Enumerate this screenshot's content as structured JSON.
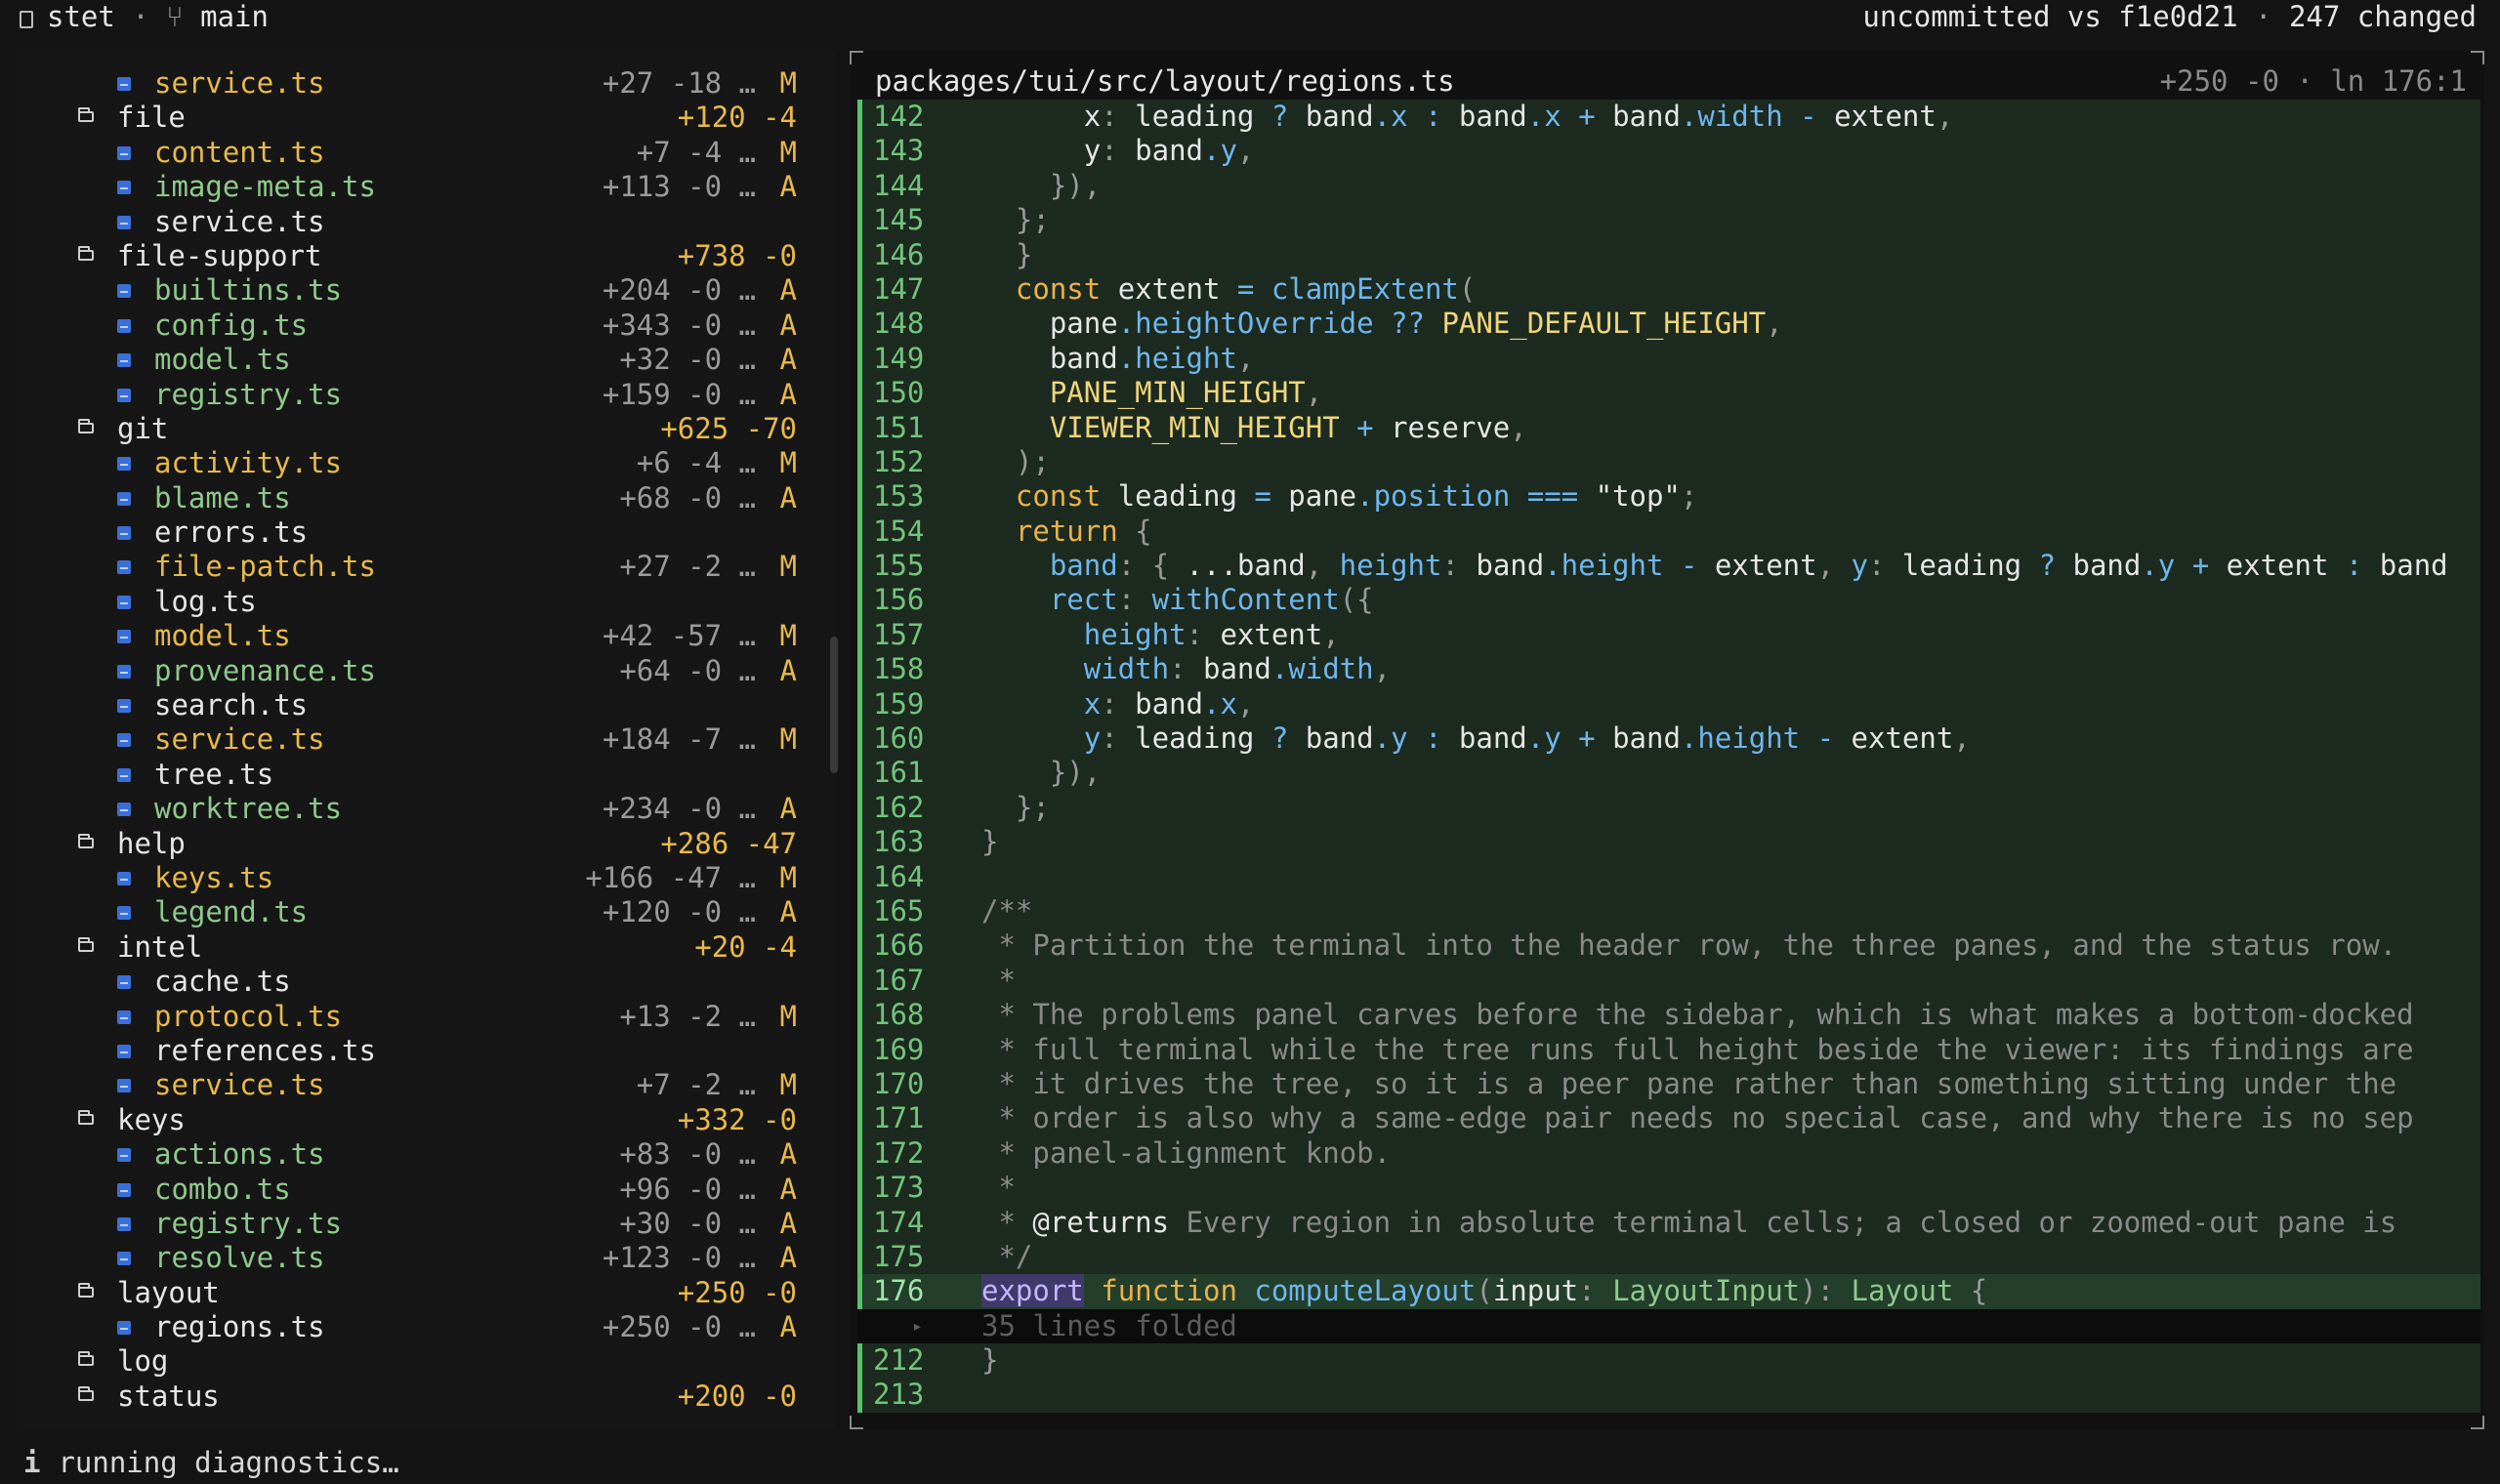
{
  "header": {
    "app_name": "stet",
    "separator": "·",
    "branch": "main",
    "compare": "uncommitted vs f1e0d21",
    "changed": "247 changed"
  },
  "sidebar": {
    "rows": [
      {
        "kind": "file",
        "depth": 2,
        "name": "service.ts",
        "stats": "+27 -18 …",
        "status": "M",
        "color": "yellow"
      },
      {
        "kind": "dir",
        "depth": 1,
        "name": "file",
        "stats": "+120 -4",
        "status": ""
      },
      {
        "kind": "file",
        "depth": 2,
        "name": "content.ts",
        "stats": "+7 -4 …",
        "status": "M",
        "color": "yellow"
      },
      {
        "kind": "file",
        "depth": 2,
        "name": "image-meta.ts",
        "stats": "+113 -0 …",
        "status": "A",
        "color": "green"
      },
      {
        "kind": "file",
        "depth": 2,
        "name": "service.ts",
        "stats": "",
        "status": "",
        "color": "white"
      },
      {
        "kind": "dir",
        "depth": 1,
        "name": "file-support",
        "stats": "+738 -0",
        "status": ""
      },
      {
        "kind": "file",
        "depth": 2,
        "name": "builtins.ts",
        "stats": "+204 -0 …",
        "status": "A",
        "color": "green"
      },
      {
        "kind": "file",
        "depth": 2,
        "name": "config.ts",
        "stats": "+343 -0 …",
        "status": "A",
        "color": "green"
      },
      {
        "kind": "file",
        "depth": 2,
        "name": "model.ts",
        "stats": "+32 -0 …",
        "status": "A",
        "color": "green"
      },
      {
        "kind": "file",
        "depth": 2,
        "name": "registry.ts",
        "stats": "+159 -0 …",
        "status": "A",
        "color": "green"
      },
      {
        "kind": "dir",
        "depth": 1,
        "name": "git",
        "stats": "+625 -70",
        "status": ""
      },
      {
        "kind": "file",
        "depth": 2,
        "name": "activity.ts",
        "stats": "+6 -4 …",
        "status": "M",
        "color": "yellow"
      },
      {
        "kind": "file",
        "depth": 2,
        "name": "blame.ts",
        "stats": "+68 -0 …",
        "status": "A",
        "color": "green"
      },
      {
        "kind": "file",
        "depth": 2,
        "name": "errors.ts",
        "stats": "",
        "status": "",
        "color": "white"
      },
      {
        "kind": "file",
        "depth": 2,
        "name": "file-patch.ts",
        "stats": "+27 -2 …",
        "status": "M",
        "color": "yellow"
      },
      {
        "kind": "file",
        "depth": 2,
        "name": "log.ts",
        "stats": "",
        "status": "",
        "color": "white"
      },
      {
        "kind": "file",
        "depth": 2,
        "name": "model.ts",
        "stats": "+42 -57 …",
        "status": "M",
        "color": "yellow"
      },
      {
        "kind": "file",
        "depth": 2,
        "name": "provenance.ts",
        "stats": "+64 -0 …",
        "status": "A",
        "color": "green"
      },
      {
        "kind": "file",
        "depth": 2,
        "name": "search.ts",
        "stats": "",
        "status": "",
        "color": "white"
      },
      {
        "kind": "file",
        "depth": 2,
        "name": "service.ts",
        "stats": "+184 -7 …",
        "status": "M",
        "color": "yellow"
      },
      {
        "kind": "file",
        "depth": 2,
        "name": "tree.ts",
        "stats": "",
        "status": "",
        "color": "white"
      },
      {
        "kind": "file",
        "depth": 2,
        "name": "worktree.ts",
        "stats": "+234 -0 …",
        "status": "A",
        "color": "green"
      },
      {
        "kind": "dir",
        "depth": 1,
        "name": "help",
        "stats": "+286 -47",
        "status": ""
      },
      {
        "kind": "file",
        "depth": 2,
        "name": "keys.ts",
        "stats": "+166 -47 …",
        "status": "M",
        "color": "yellow"
      },
      {
        "kind": "file",
        "depth": 2,
        "name": "legend.ts",
        "stats": "+120 -0 …",
        "status": "A",
        "color": "green"
      },
      {
        "kind": "dir",
        "depth": 1,
        "name": "intel",
        "stats": "+20 -4",
        "status": ""
      },
      {
        "kind": "file",
        "depth": 2,
        "name": "cache.ts",
        "stats": "",
        "status": "",
        "color": "white"
      },
      {
        "kind": "file",
        "depth": 2,
        "name": "protocol.ts",
        "stats": "+13 -2 …",
        "status": "M",
        "color": "yellow"
      },
      {
        "kind": "file",
        "depth": 2,
        "name": "references.ts",
        "stats": "",
        "status": "",
        "color": "white"
      },
      {
        "kind": "file",
        "depth": 2,
        "name": "service.ts",
        "stats": "+7 -2 …",
        "status": "M",
        "color": "yellow"
      },
      {
        "kind": "dir",
        "depth": 1,
        "name": "keys",
        "stats": "+332 -0",
        "status": ""
      },
      {
        "kind": "file",
        "depth": 2,
        "name": "actions.ts",
        "stats": "+83 -0 …",
        "status": "A",
        "color": "green"
      },
      {
        "kind": "file",
        "depth": 2,
        "name": "combo.ts",
        "stats": "+96 -0 …",
        "status": "A",
        "color": "green"
      },
      {
        "kind": "file",
        "depth": 2,
        "name": "registry.ts",
        "stats": "+30 -0 …",
        "status": "A",
        "color": "green"
      },
      {
        "kind": "file",
        "depth": 2,
        "name": "resolve.ts",
        "stats": "+123 -0 …",
        "status": "A",
        "color": "green"
      },
      {
        "kind": "dir",
        "depth": 1,
        "name": "layout",
        "stats": "+250 -0",
        "status": ""
      },
      {
        "kind": "file",
        "depth": 2,
        "name": "regions.ts",
        "stats": "+250 -0 …",
        "status": "A",
        "color": "white"
      },
      {
        "kind": "dir",
        "depth": 1,
        "name": "log",
        "stats": "",
        "status": "",
        "empty": true
      },
      {
        "kind": "dir",
        "depth": 1,
        "name": "status",
        "stats": "+200 -0",
        "status": ""
      }
    ]
  },
  "viewer": {
    "path": "packages/tui/src/layout/regions.ts",
    "added": "+250",
    "removed": "-0",
    "separator": "·",
    "cursor": "ln 176:1",
    "lines": [
      {
        "n": "142",
        "t": [
          [
            "      ",
            ""
          ],
          [
            "x",
            ""
          ],
          [
            ": ",
            "pn"
          ],
          [
            "leading ",
            ""
          ],
          [
            "? ",
            "op"
          ],
          [
            "band",
            ""
          ],
          [
            ".x ",
            "pr"
          ],
          [
            ": ",
            "op"
          ],
          [
            "band",
            ""
          ],
          [
            ".x ",
            "pr"
          ],
          [
            "+ ",
            "op"
          ],
          [
            "band",
            ""
          ],
          [
            ".width ",
            "pr"
          ],
          [
            "- ",
            "op"
          ],
          [
            "extent",
            ""
          ],
          [
            ",",
            "pn"
          ]
        ]
      },
      {
        "n": "143",
        "t": [
          [
            "      ",
            ""
          ],
          [
            "y",
            ""
          ],
          [
            ": ",
            "pn"
          ],
          [
            "band",
            ""
          ],
          [
            ".y",
            "pr"
          ],
          [
            ",",
            "pn"
          ]
        ]
      },
      {
        "n": "144",
        "t": [
          [
            "    ",
            ""
          ],
          [
            "}),",
            "pn"
          ]
        ]
      },
      {
        "n": "145",
        "t": [
          [
            "  ",
            ""
          ],
          [
            "};",
            "pn"
          ]
        ]
      },
      {
        "n": "146",
        "t": [
          [
            "  ",
            ""
          ],
          [
            "}",
            "pn"
          ]
        ]
      },
      {
        "n": "147",
        "t": [
          [
            "  ",
            ""
          ],
          [
            "const ",
            "kw"
          ],
          [
            "extent ",
            ""
          ],
          [
            "= ",
            "op"
          ],
          [
            "clampExtent",
            "fn"
          ],
          [
            "(",
            "pn"
          ]
        ]
      },
      {
        "n": "148",
        "t": [
          [
            "    ",
            ""
          ],
          [
            "pane",
            ""
          ],
          [
            ".heightOverride ",
            "pr"
          ],
          [
            "?? ",
            "op"
          ],
          [
            "PANE_DEFAULT_HEIGHT",
            "cst"
          ],
          [
            ",",
            "pn"
          ]
        ]
      },
      {
        "n": "149",
        "t": [
          [
            "    ",
            ""
          ],
          [
            "band",
            ""
          ],
          [
            ".height",
            "pr"
          ],
          [
            ",",
            "pn"
          ]
        ]
      },
      {
        "n": "150",
        "t": [
          [
            "    ",
            ""
          ],
          [
            "PANE_MIN_HEIGHT",
            "cst"
          ],
          [
            ",",
            "pn"
          ]
        ]
      },
      {
        "n": "151",
        "t": [
          [
            "    ",
            ""
          ],
          [
            "VIEWER_MIN_HEIGHT ",
            "cst"
          ],
          [
            "+ ",
            "op"
          ],
          [
            "reserve",
            ""
          ],
          [
            ",",
            "pn"
          ]
        ]
      },
      {
        "n": "152",
        "t": [
          [
            "  ",
            ""
          ],
          [
            ");",
            "pn"
          ]
        ]
      },
      {
        "n": "153",
        "t": [
          [
            "  ",
            ""
          ],
          [
            "const ",
            "kw"
          ],
          [
            "leading ",
            ""
          ],
          [
            "= ",
            "op"
          ],
          [
            "pane",
            ""
          ],
          [
            ".position ",
            "pr"
          ],
          [
            "=== ",
            "op"
          ],
          [
            "\"top\"",
            "str"
          ],
          [
            ";",
            "pn"
          ]
        ]
      },
      {
        "n": "154",
        "t": [
          [
            "  ",
            ""
          ],
          [
            "return ",
            "kw"
          ],
          [
            "{",
            "pn"
          ]
        ]
      },
      {
        "n": "155",
        "t": [
          [
            "    ",
            ""
          ],
          [
            "band",
            "pr"
          ],
          [
            ": ",
            "pn"
          ],
          [
            "{ ",
            "pn"
          ],
          [
            "...band",
            ""
          ],
          [
            ", ",
            "pn"
          ],
          [
            "height",
            "pr"
          ],
          [
            ": ",
            "pn"
          ],
          [
            "band",
            ""
          ],
          [
            ".height ",
            "pr"
          ],
          [
            "- ",
            "op"
          ],
          [
            "extent",
            ""
          ],
          [
            ", ",
            "pn"
          ],
          [
            "y",
            "pr"
          ],
          [
            ": ",
            "pn"
          ],
          [
            "leading ",
            ""
          ],
          [
            "? ",
            "op"
          ],
          [
            "band",
            ""
          ],
          [
            ".y ",
            "pr"
          ],
          [
            "+ ",
            "op"
          ],
          [
            "extent ",
            ""
          ],
          [
            ": ",
            "op"
          ],
          [
            "band",
            ""
          ]
        ]
      },
      {
        "n": "156",
        "t": [
          [
            "    ",
            ""
          ],
          [
            "rect",
            "pr"
          ],
          [
            ": ",
            "pn"
          ],
          [
            "withContent",
            "fn"
          ],
          [
            "({",
            "pn"
          ]
        ]
      },
      {
        "n": "157",
        "t": [
          [
            "      ",
            ""
          ],
          [
            "height",
            "pr"
          ],
          [
            ": ",
            "pn"
          ],
          [
            "extent",
            ""
          ],
          [
            ",",
            "pn"
          ]
        ]
      },
      {
        "n": "158",
        "t": [
          [
            "      ",
            ""
          ],
          [
            "width",
            "pr"
          ],
          [
            ": ",
            "pn"
          ],
          [
            "band",
            ""
          ],
          [
            ".width",
            "pr"
          ],
          [
            ",",
            "pn"
          ]
        ]
      },
      {
        "n": "159",
        "t": [
          [
            "      ",
            ""
          ],
          [
            "x",
            "pr"
          ],
          [
            ": ",
            "pn"
          ],
          [
            "band",
            ""
          ],
          [
            ".x",
            "pr"
          ],
          [
            ",",
            "pn"
          ]
        ]
      },
      {
        "n": "160",
        "t": [
          [
            "      ",
            ""
          ],
          [
            "y",
            "pr"
          ],
          [
            ": ",
            "pn"
          ],
          [
            "leading ",
            ""
          ],
          [
            "? ",
            "op"
          ],
          [
            "band",
            ""
          ],
          [
            ".y ",
            "pr"
          ],
          [
            ": ",
            "op"
          ],
          [
            "band",
            ""
          ],
          [
            ".y ",
            "pr"
          ],
          [
            "+ ",
            "op"
          ],
          [
            "band",
            ""
          ],
          [
            ".height ",
            "pr"
          ],
          [
            "- ",
            "op"
          ],
          [
            "extent",
            ""
          ],
          [
            ",",
            "pn"
          ]
        ]
      },
      {
        "n": "161",
        "t": [
          [
            "    ",
            ""
          ],
          [
            "}),",
            "pn"
          ]
        ]
      },
      {
        "n": "162",
        "t": [
          [
            "  ",
            ""
          ],
          [
            "};",
            "pn"
          ]
        ]
      },
      {
        "n": "163",
        "t": [
          [
            "",
            ""
          ],
          [
            "}",
            "pn"
          ]
        ]
      },
      {
        "n": "164",
        "t": []
      },
      {
        "n": "165",
        "t": [
          [
            "/**",
            "cm"
          ]
        ]
      },
      {
        "n": "166",
        "t": [
          [
            " * Partition the terminal into the header row, the three panes, and the status row.",
            "cm"
          ]
        ]
      },
      {
        "n": "167",
        "t": [
          [
            " *",
            "cm"
          ]
        ]
      },
      {
        "n": "168",
        "t": [
          [
            " * The problems panel carves before the sidebar, which is what makes a bottom-docked",
            "cm"
          ]
        ]
      },
      {
        "n": "169",
        "t": [
          [
            " * full terminal while the tree runs full height beside the viewer: its findings are",
            "cm"
          ]
        ]
      },
      {
        "n": "170",
        "t": [
          [
            " * it drives the tree, so it is a peer pane rather than something sitting under the",
            "cm"
          ]
        ]
      },
      {
        "n": "171",
        "t": [
          [
            " * order is also why a same-edge pair needs no special case, and why there is no sep",
            "cm"
          ]
        ]
      },
      {
        "n": "172",
        "t": [
          [
            " * panel-alignment knob.",
            "cm"
          ]
        ]
      },
      {
        "n": "173",
        "t": [
          [
            " *",
            "cm"
          ]
        ]
      },
      {
        "n": "174",
        "t": [
          [
            " * ",
            "cm"
          ],
          [
            "@returns",
            "c-white"
          ],
          [
            " Every region in absolute terminal cells; a closed or zoomed-out pane is",
            "cm"
          ]
        ]
      },
      {
        "n": "175",
        "t": [
          [
            " */",
            "cm"
          ]
        ]
      },
      {
        "n": "176",
        "active": true,
        "t": [
          [
            "export",
            "exp"
          ],
          [
            " ",
            ""
          ],
          [
            "function ",
            "kw"
          ],
          [
            "computeLayout",
            "fn"
          ],
          [
            "(",
            "pn"
          ],
          [
            "input",
            ""
          ],
          [
            ": ",
            "pn"
          ],
          [
            "LayoutInput",
            "ty"
          ],
          [
            "): ",
            "pn"
          ],
          [
            "Layout ",
            "ty"
          ],
          [
            "{",
            "pn"
          ]
        ]
      },
      {
        "n": "",
        "fold": true,
        "t": [
          [
            "35 lines folded",
            ""
          ]
        ]
      },
      {
        "n": "212",
        "t": [
          [
            "",
            ""
          ],
          [
            "}",
            "pn"
          ]
        ]
      },
      {
        "n": "213",
        "t": []
      }
    ]
  },
  "statusbar": {
    "icon": "i",
    "message": "running diagnostics…"
  }
}
